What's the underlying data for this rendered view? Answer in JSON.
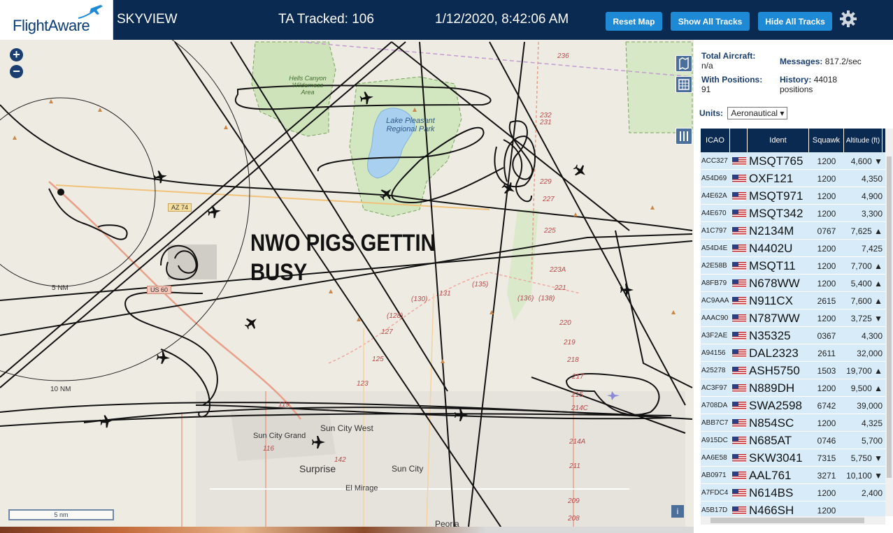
{
  "header": {
    "logo_text": "FlightAware",
    "app_title": "SKYVIEW",
    "ta_tracked": "TA Tracked: 106",
    "timestamp": "1/12/2020, 8:42:06 AM",
    "buttons": {
      "reset": "Reset Map",
      "show_all": "Show All Tracks",
      "hide_all": "Hide All Tracks"
    },
    "settings_icon": "gear-icon"
  },
  "map": {
    "zoom_in": "+",
    "zoom_out": "−",
    "overlay_text_line1": "NWO PIGS GETTIN",
    "overlay_text_line2": "BUSY",
    "scale_bar_label": "5 nm",
    "range_rings": [
      "5 NM",
      "10 NM"
    ],
    "place_labels": {
      "wilderness": "Hells Canyon Wilderness Area",
      "lake": "Lake Pleasant Regional Park",
      "sun_city_west": "Sun City West",
      "sun_city_grand": "Sun City Grand",
      "surprise": "Surprise",
      "sun_city": "Sun City",
      "el_mirage": "El Mirage",
      "peoria": "Peoria"
    },
    "road_labels": {
      "az74": "AZ 74",
      "us60": "US 60",
      "r131": "131",
      "r135": "(135)",
      "r130": "(130)",
      "r128": "(128)",
      "r127": "127",
      "r125": "125",
      "r123": "123",
      "r119": "119",
      "r116": "116",
      "r142": "142",
      "r136": "(136)",
      "r138": "(138)",
      "r221": "221",
      "r220": "220",
      "r219": "219",
      "r218": "218",
      "r217": "217",
      "r215": "215",
      "r214c": "214C",
      "r214a": "214A",
      "r211": "211",
      "r209": "209",
      "r208": "208",
      "r223a": "223A",
      "r225": "225",
      "r227": "227",
      "r229": "229",
      "r231": "231",
      "r232": "232",
      "r236": "236"
    },
    "side_icons": [
      "map-layers-icon",
      "grid-icon",
      "columns-icon"
    ],
    "info_icon": "i"
  },
  "panel": {
    "stats": {
      "total_aircraft_label": "Total Aircraft:",
      "total_aircraft_value": "n/a",
      "messages_label": "Messages:",
      "messages_value": "817.2/sec",
      "with_positions_label": "With Positions:",
      "with_positions_value": "91",
      "history_label": "History:",
      "history_value": "44018",
      "history_unit": "positions"
    },
    "units_label": "Units:",
    "units_value": "Aeronautical ▾",
    "columns": [
      "ICAO",
      "",
      "Ident",
      "Squawk",
      "Altitude (ft)"
    ],
    "rows": [
      {
        "icao": "ACC327",
        "ident": "MSQT765",
        "squawk": "1200",
        "alt": "4,600 ▼"
      },
      {
        "icao": "A54D69",
        "ident": "OXF121",
        "squawk": "1200",
        "alt": "4,350"
      },
      {
        "icao": "A4E62A",
        "ident": "MSQT971",
        "squawk": "1200",
        "alt": "4,900"
      },
      {
        "icao": "A4E670",
        "ident": "MSQT342",
        "squawk": "1200",
        "alt": "3,300"
      },
      {
        "icao": "A1C797",
        "ident": "N2134M",
        "squawk": "0767",
        "alt": "7,625 ▲"
      },
      {
        "icao": "A54D4E",
        "ident": "N4402U",
        "squawk": "1200",
        "alt": "7,425"
      },
      {
        "icao": "A2E58B",
        "ident": "MSQT11",
        "squawk": "1200",
        "alt": "7,700 ▲"
      },
      {
        "icao": "A8FB79",
        "ident": "N678WW",
        "squawk": "1200",
        "alt": "5,400 ▲"
      },
      {
        "icao": "AC9AAA",
        "ident": "N911CX",
        "squawk": "2615",
        "alt": "7,600 ▲"
      },
      {
        "icao": "AAAC90",
        "ident": "N787WW",
        "squawk": "1200",
        "alt": "3,725 ▼"
      },
      {
        "icao": "A3F2AE",
        "ident": "N35325",
        "squawk": "0367",
        "alt": "4,300"
      },
      {
        "icao": "A94156",
        "ident": "DAL2323",
        "squawk": "2611",
        "alt": "32,000"
      },
      {
        "icao": "A25278",
        "ident": "ASH5750",
        "squawk": "1503",
        "alt": "19,700 ▲"
      },
      {
        "icao": "AC3F97",
        "ident": "N889DH",
        "squawk": "1200",
        "alt": "9,500 ▲"
      },
      {
        "icao": "A708DA",
        "ident": "SWA2598",
        "squawk": "6742",
        "alt": "39,000"
      },
      {
        "icao": "ABB7C7",
        "ident": "N854SC",
        "squawk": "1200",
        "alt": "4,325"
      },
      {
        "icao": "A915DC",
        "ident": "N685AT",
        "squawk": "0746",
        "alt": "5,700"
      },
      {
        "icao": "AA6E58",
        "ident": "SKW3041",
        "squawk": "7315",
        "alt": "5,750 ▼"
      },
      {
        "icao": "AB0971",
        "ident": "AAL761",
        "squawk": "3271",
        "alt": "10,100 ▼"
      },
      {
        "icao": "A7FDC4",
        "ident": "N614BS",
        "squawk": "1200",
        "alt": "2,400"
      },
      {
        "icao": "A5B17D",
        "ident": "N466SH",
        "squawk": "1200",
        "alt": ""
      }
    ]
  }
}
